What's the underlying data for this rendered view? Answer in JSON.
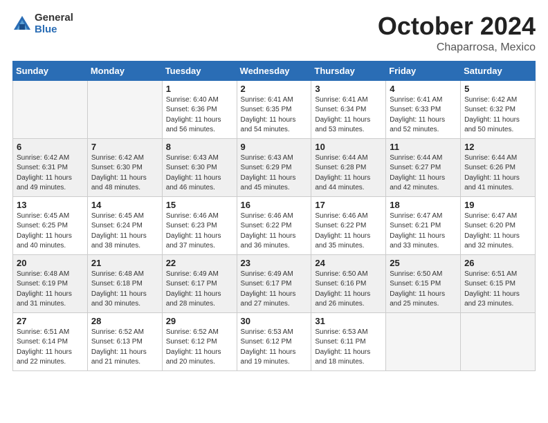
{
  "header": {
    "logo_general": "General",
    "logo_blue": "Blue",
    "month_title": "October 2024",
    "location": "Chaparrosa, Mexico"
  },
  "days_of_week": [
    "Sunday",
    "Monday",
    "Tuesday",
    "Wednesday",
    "Thursday",
    "Friday",
    "Saturday"
  ],
  "weeks": [
    [
      {
        "day": "",
        "info": ""
      },
      {
        "day": "",
        "info": ""
      },
      {
        "day": "1",
        "info": "Sunrise: 6:40 AM\nSunset: 6:36 PM\nDaylight: 11 hours and 56 minutes."
      },
      {
        "day": "2",
        "info": "Sunrise: 6:41 AM\nSunset: 6:35 PM\nDaylight: 11 hours and 54 minutes."
      },
      {
        "day": "3",
        "info": "Sunrise: 6:41 AM\nSunset: 6:34 PM\nDaylight: 11 hours and 53 minutes."
      },
      {
        "day": "4",
        "info": "Sunrise: 6:41 AM\nSunset: 6:33 PM\nDaylight: 11 hours and 52 minutes."
      },
      {
        "day": "5",
        "info": "Sunrise: 6:42 AM\nSunset: 6:32 PM\nDaylight: 11 hours and 50 minutes."
      }
    ],
    [
      {
        "day": "6",
        "info": "Sunrise: 6:42 AM\nSunset: 6:31 PM\nDaylight: 11 hours and 49 minutes."
      },
      {
        "day": "7",
        "info": "Sunrise: 6:42 AM\nSunset: 6:30 PM\nDaylight: 11 hours and 48 minutes."
      },
      {
        "day": "8",
        "info": "Sunrise: 6:43 AM\nSunset: 6:30 PM\nDaylight: 11 hours and 46 minutes."
      },
      {
        "day": "9",
        "info": "Sunrise: 6:43 AM\nSunset: 6:29 PM\nDaylight: 11 hours and 45 minutes."
      },
      {
        "day": "10",
        "info": "Sunrise: 6:44 AM\nSunset: 6:28 PM\nDaylight: 11 hours and 44 minutes."
      },
      {
        "day": "11",
        "info": "Sunrise: 6:44 AM\nSunset: 6:27 PM\nDaylight: 11 hours and 42 minutes."
      },
      {
        "day": "12",
        "info": "Sunrise: 6:44 AM\nSunset: 6:26 PM\nDaylight: 11 hours and 41 minutes."
      }
    ],
    [
      {
        "day": "13",
        "info": "Sunrise: 6:45 AM\nSunset: 6:25 PM\nDaylight: 11 hours and 40 minutes."
      },
      {
        "day": "14",
        "info": "Sunrise: 6:45 AM\nSunset: 6:24 PM\nDaylight: 11 hours and 38 minutes."
      },
      {
        "day": "15",
        "info": "Sunrise: 6:46 AM\nSunset: 6:23 PM\nDaylight: 11 hours and 37 minutes."
      },
      {
        "day": "16",
        "info": "Sunrise: 6:46 AM\nSunset: 6:22 PM\nDaylight: 11 hours and 36 minutes."
      },
      {
        "day": "17",
        "info": "Sunrise: 6:46 AM\nSunset: 6:22 PM\nDaylight: 11 hours and 35 minutes."
      },
      {
        "day": "18",
        "info": "Sunrise: 6:47 AM\nSunset: 6:21 PM\nDaylight: 11 hours and 33 minutes."
      },
      {
        "day": "19",
        "info": "Sunrise: 6:47 AM\nSunset: 6:20 PM\nDaylight: 11 hours and 32 minutes."
      }
    ],
    [
      {
        "day": "20",
        "info": "Sunrise: 6:48 AM\nSunset: 6:19 PM\nDaylight: 11 hours and 31 minutes."
      },
      {
        "day": "21",
        "info": "Sunrise: 6:48 AM\nSunset: 6:18 PM\nDaylight: 11 hours and 30 minutes."
      },
      {
        "day": "22",
        "info": "Sunrise: 6:49 AM\nSunset: 6:17 PM\nDaylight: 11 hours and 28 minutes."
      },
      {
        "day": "23",
        "info": "Sunrise: 6:49 AM\nSunset: 6:17 PM\nDaylight: 11 hours and 27 minutes."
      },
      {
        "day": "24",
        "info": "Sunrise: 6:50 AM\nSunset: 6:16 PM\nDaylight: 11 hours and 26 minutes."
      },
      {
        "day": "25",
        "info": "Sunrise: 6:50 AM\nSunset: 6:15 PM\nDaylight: 11 hours and 25 minutes."
      },
      {
        "day": "26",
        "info": "Sunrise: 6:51 AM\nSunset: 6:15 PM\nDaylight: 11 hours and 23 minutes."
      }
    ],
    [
      {
        "day": "27",
        "info": "Sunrise: 6:51 AM\nSunset: 6:14 PM\nDaylight: 11 hours and 22 minutes."
      },
      {
        "day": "28",
        "info": "Sunrise: 6:52 AM\nSunset: 6:13 PM\nDaylight: 11 hours and 21 minutes."
      },
      {
        "day": "29",
        "info": "Sunrise: 6:52 AM\nSunset: 6:12 PM\nDaylight: 11 hours and 20 minutes."
      },
      {
        "day": "30",
        "info": "Sunrise: 6:53 AM\nSunset: 6:12 PM\nDaylight: 11 hours and 19 minutes."
      },
      {
        "day": "31",
        "info": "Sunrise: 6:53 AM\nSunset: 6:11 PM\nDaylight: 11 hours and 18 minutes."
      },
      {
        "day": "",
        "info": ""
      },
      {
        "day": "",
        "info": ""
      }
    ]
  ]
}
